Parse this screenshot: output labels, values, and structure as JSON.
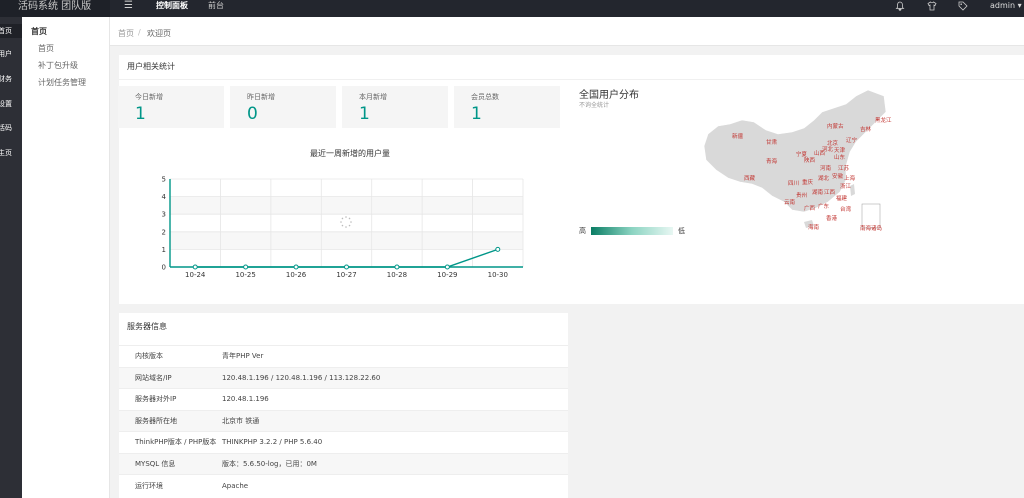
{
  "header": {
    "brand": "活码系统 团队版",
    "nav": [
      "控制面板",
      "前台"
    ],
    "user": "admin ▾",
    "icons": [
      "bell-icon",
      "shirt-icon",
      "tag-icon"
    ]
  },
  "sidebar": {
    "items": [
      {
        "label": "首页",
        "active": true
      },
      {
        "label": "用户"
      },
      {
        "label": "财务"
      },
      {
        "label": "设置"
      },
      {
        "label": "活码"
      },
      {
        "label": "主页"
      }
    ]
  },
  "subnav": {
    "group": "首页",
    "items": [
      "首页",
      "补丁包升级",
      "计划任务管理"
    ]
  },
  "breadcrumb": {
    "items": [
      "首页",
      "/",
      "欢迎页"
    ]
  },
  "stats": {
    "title": "用户相关统计",
    "cards": [
      {
        "label": "今日新增",
        "value": "1"
      },
      {
        "label": "昨日新增",
        "value": "0"
      },
      {
        "label": "本月新增",
        "value": "1"
      },
      {
        "label": "会员总数",
        "value": "1"
      }
    ]
  },
  "chart_data": {
    "type": "line",
    "title": "最近一周新增的用户量",
    "categories": [
      "10-24",
      "10-25",
      "10-26",
      "10-27",
      "10-28",
      "10-29",
      "10-30"
    ],
    "values": [
      0,
      0,
      0,
      0,
      0,
      0,
      1
    ],
    "yticks": [
      0,
      1,
      2,
      3,
      4,
      5
    ],
    "ylim": [
      0,
      5
    ],
    "grid": true,
    "color": "#009688"
  },
  "map": {
    "title": "全国用户分布",
    "subtitle": "不询全统计",
    "legend_high": "高",
    "legend_low": "低",
    "provinces": [
      "黑龙江",
      "吉林",
      "内蒙古",
      "辽宁",
      "新疆",
      "甘肃",
      "北京",
      "天津",
      "河北",
      "宁夏",
      "山西",
      "山东",
      "青海",
      "陕西",
      "河南",
      "江苏",
      "西藏",
      "四川",
      "重庆",
      "湖北",
      "安徽",
      "上海",
      "浙江",
      "湖南",
      "江西",
      "贵州",
      "福建",
      "云南",
      "广西",
      "广东",
      "台湾",
      "香港",
      "海南",
      "南海诸岛"
    ]
  },
  "server": {
    "title": "服务器信息",
    "rows": [
      {
        "key": "内核版本",
        "value": "青年PHP Ver"
      },
      {
        "key": "网站域名/IP",
        "value": "120.48.1.196 / 120.48.1.196 / 113.128.22.60"
      },
      {
        "key": "服务器对外IP",
        "value": "120.48.1.196"
      },
      {
        "key": "服务器所在地",
        "value": "北京市 铁通"
      },
      {
        "key": "ThinkPHP版本 / PHP版本",
        "value": "THINKPHP 3.2.2 / PHP 5.6.40"
      },
      {
        "key": "MYSQL 信息",
        "value": "版本：5.6.50-log，已用：0M"
      },
      {
        "key": "运行环境",
        "value": "Apache"
      }
    ]
  }
}
